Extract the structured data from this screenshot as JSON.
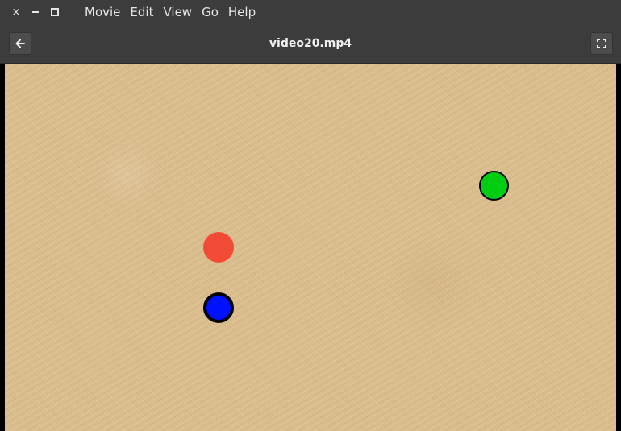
{
  "menubar": {
    "close_glyph": "×",
    "items": [
      "Movie",
      "Edit",
      "View",
      "Go",
      "Help"
    ]
  },
  "header": {
    "title": "video20.mp4"
  },
  "colors": {
    "chrome": "#3c3c3c",
    "background": "#dcbf8e",
    "ball_green": "#00cc11",
    "ball_red": "#f24b35",
    "ball_blue": "#0011ff",
    "ball_outline": "#000000"
  },
  "icons": {
    "back": "arrow-left-icon",
    "fullscreen": "fullscreen-icon"
  }
}
